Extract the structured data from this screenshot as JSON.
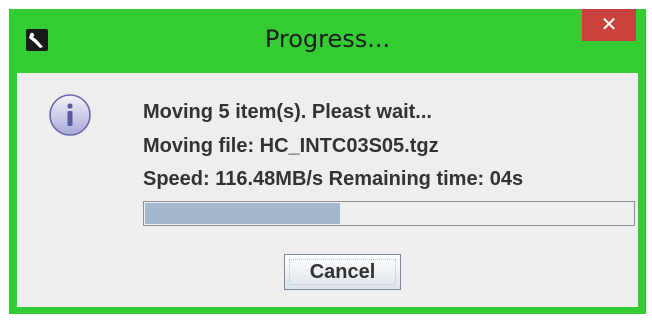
{
  "window": {
    "title": "Progress...",
    "close_label": "✕",
    "app_icon": "app-icon"
  },
  "dialog": {
    "icon": "info-icon",
    "line1": "Moving 5 item(s). Pleast wait...",
    "line2": "Moving file: HC_INTC03S05.tgz",
    "line3": "Speed: 116.48MB/s Remaining time: 04s",
    "progress_fraction": 0.4,
    "cancel_label": "Cancel"
  },
  "colors": {
    "frame": "#33cc33",
    "close_button": "#c9413c",
    "progress_fill": "#a3b8cc",
    "body": "#eeeeee"
  }
}
